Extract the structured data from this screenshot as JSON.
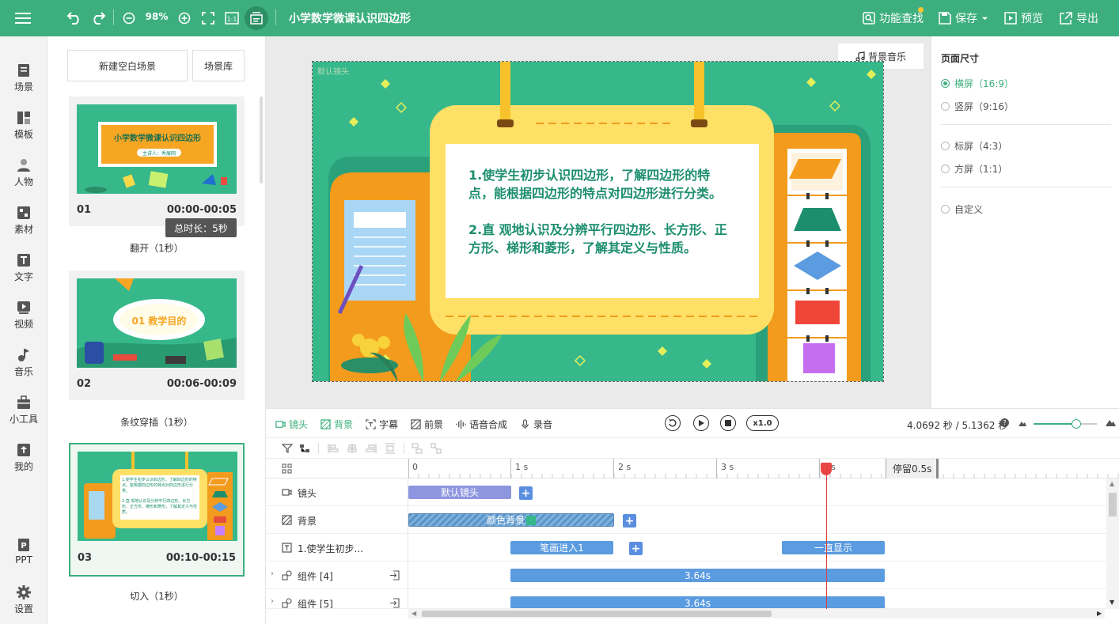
{
  "header": {
    "zoom": "98%",
    "title": "小学数学微课认识四边形",
    "actions": {
      "find": "功能查找",
      "save": "保存",
      "preview": "预览",
      "export": "导出"
    }
  },
  "nav": {
    "items": [
      "场景",
      "模板",
      "人物",
      "素材",
      "文字",
      "视频",
      "音乐",
      "小工具",
      "我的",
      "PPT",
      "设置"
    ]
  },
  "scenes": {
    "new_blank": "新建空白场景",
    "library": "场景库",
    "tooltip": "总时长：5秒",
    "list": [
      {
        "num": "01",
        "time": "00:00-00:05",
        "transition": "翻开（1秒）",
        "thumb_title": "小学数学微课认识四边形",
        "thumb_sub": "主讲人：秀展网"
      },
      {
        "num": "02",
        "time": "00:06-00:09",
        "transition": "条纹穿插（1秒）",
        "thumb_title": "01 教学目的"
      },
      {
        "num": "03",
        "time": "00:10-00:15",
        "transition": "切入（1秒）"
      }
    ]
  },
  "canvas": {
    "bgm": "背景音乐",
    "tag": "默认镜头",
    "text1": "1.使学生初步认识四边形，了解四边形的特点，能根据四边形的特点对四边形进行分类。",
    "text2": "2.直 观地认识及分辨平行四边形、长方形、正方形、梯形和菱形，了解其定义与性质。"
  },
  "page_size": {
    "title": "页面尺寸",
    "options": [
      "横屏（16:9）",
      "竖屏（9:16）",
      "标屏（4:3）",
      "方屏（1:1）",
      "自定义"
    ],
    "selected": "横屏（16:9）"
  },
  "timeline_toolbar": {
    "tabs": [
      "镜头",
      "背景",
      "字幕",
      "前景",
      "语音合成",
      "录音"
    ],
    "active_tab": "背景",
    "speed": "x1.0",
    "time_readout": "4.0692 秒 / 5.1362 秒"
  },
  "timeline": {
    "ruler": [
      "0",
      "1 s",
      "2 s",
      "3 s",
      "s"
    ],
    "pause": "停留0.5s",
    "tracks": [
      {
        "name": "镜头",
        "clips": [
          "默认镜头"
        ]
      },
      {
        "name": "背景",
        "clips": [
          "颜色背景"
        ]
      },
      {
        "name": "1.使学生初步...",
        "clips": [
          "笔画进入1",
          "一直显示"
        ]
      },
      {
        "name": "组件 [4]",
        "clips": [
          "3.64s"
        ]
      },
      {
        "name": "组件 [5]",
        "clips": [
          "3.64s"
        ]
      }
    ]
  },
  "colors": {
    "brand": "#3daf7e",
    "stage_bg": "#36b88b",
    "clip_blue": "#5b9be0",
    "clip_purple": "#8e96e0",
    "playhead": "#e43b3b"
  }
}
